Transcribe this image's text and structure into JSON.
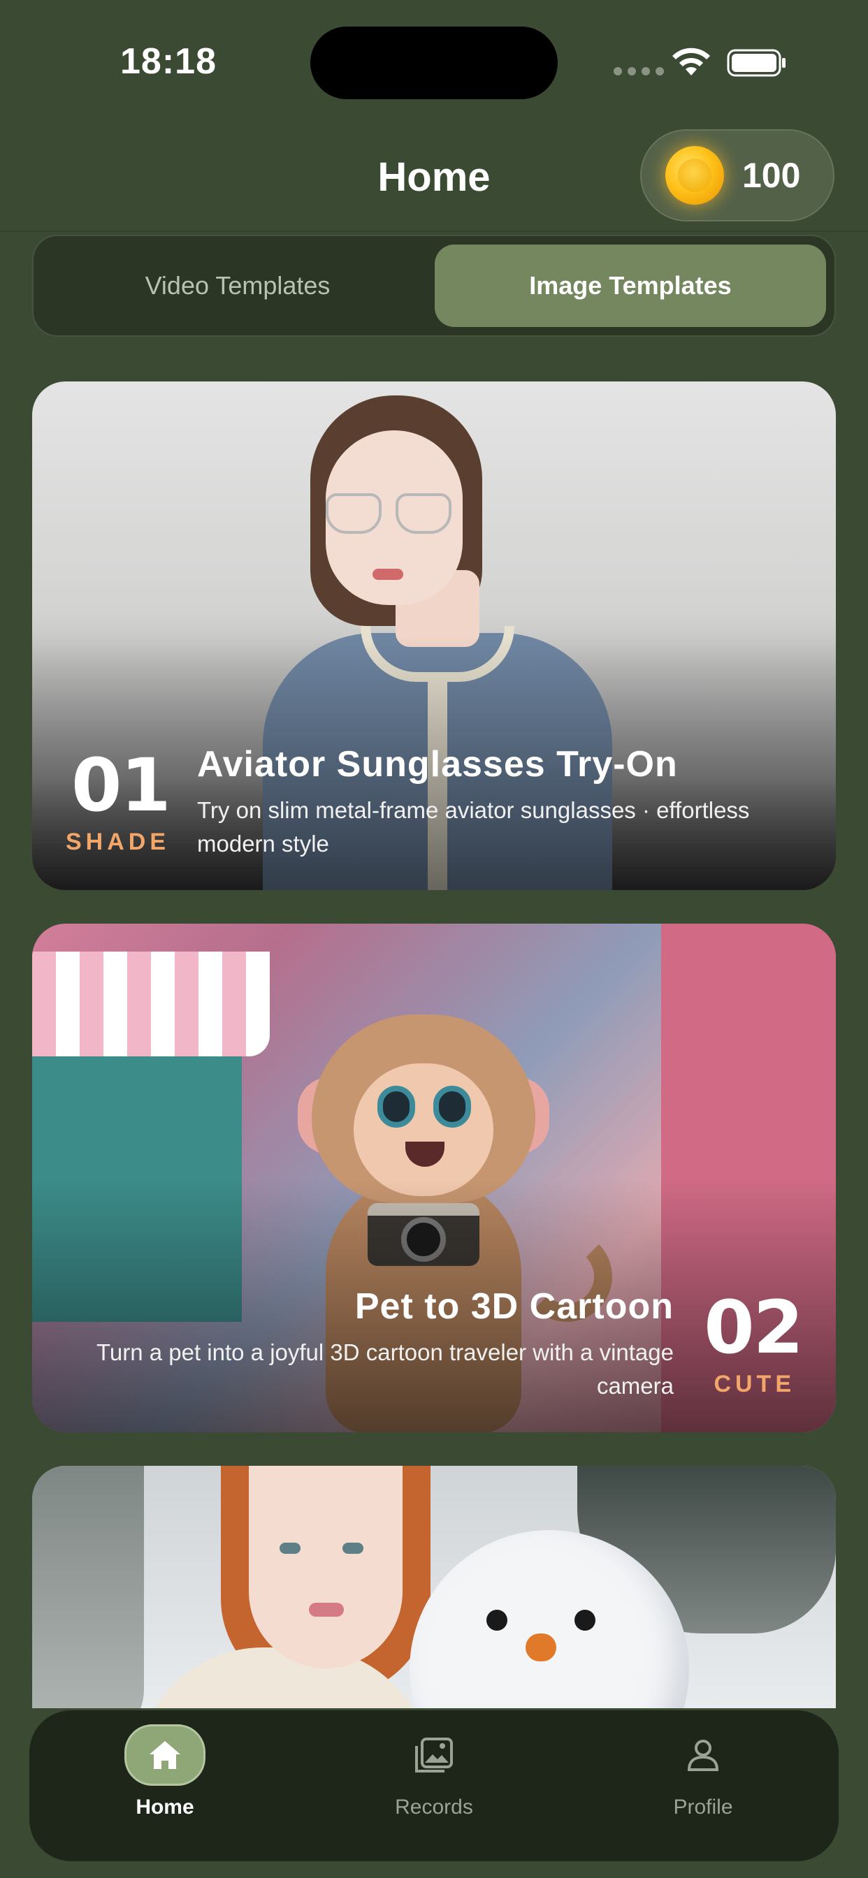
{
  "status_bar": {
    "time": "18:18",
    "icons": [
      "cellular-dots-icon",
      "wifi-icon",
      "battery-icon"
    ]
  },
  "header": {
    "title": "Home",
    "coin_balance": "100",
    "coin_icon": "gold-coin-icon"
  },
  "tabs": {
    "items": [
      {
        "label": "Video Templates",
        "selected": false
      },
      {
        "label": "Image Templates",
        "selected": true
      }
    ]
  },
  "templates": [
    {
      "number": "01",
      "tag": "SHADE",
      "title": "Aviator Sunglasses Try-On",
      "description": "Try on slim metal-frame aviator sunglasses · effortless modern style"
    },
    {
      "number": "02",
      "tag": "CUTE",
      "title": "Pet to 3D Cartoon",
      "description": "Turn a pet into a joyful 3D cartoon traveler with a vintage camera"
    },
    {
      "number": "",
      "tag": "",
      "title": "",
      "description": ""
    }
  ],
  "bottom_nav": {
    "items": [
      {
        "label": "Home",
        "icon": "home-icon",
        "selected": true
      },
      {
        "label": "Records",
        "icon": "image-gallery-icon",
        "selected": false
      },
      {
        "label": "Profile",
        "icon": "person-icon",
        "selected": false
      }
    ]
  },
  "colors": {
    "background": "#3b4a33",
    "tab_selected": "#75875f",
    "tag_accent": "#f2a66a",
    "nav_bar": "#1d2619",
    "nav_selected": "#8fa677"
  }
}
